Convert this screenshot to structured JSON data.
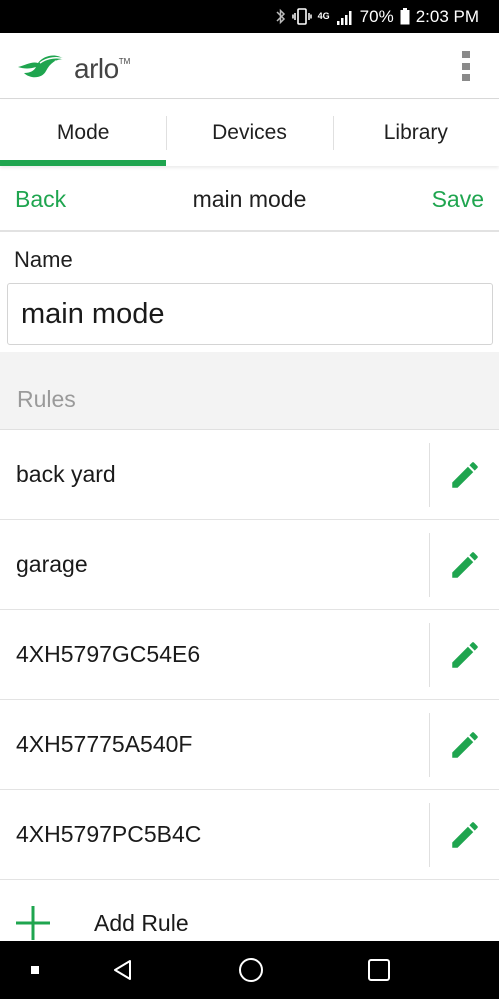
{
  "status_bar": {
    "battery": "70%",
    "time": "2:03 PM",
    "network": "4G",
    "icons": [
      "bluetooth-icon",
      "vibrate-icon",
      "network-4g-icon",
      "signal-icon",
      "battery-icon"
    ]
  },
  "app": {
    "logo_text": "arlo",
    "logo_tm": "TM"
  },
  "tabs": [
    {
      "label": "Mode",
      "active": true
    },
    {
      "label": "Devices",
      "active": false
    },
    {
      "label": "Library",
      "active": false
    }
  ],
  "toolbar": {
    "back_label": "Back",
    "title": "main mode",
    "save_label": "Save"
  },
  "name_section": {
    "label": "Name",
    "value": "main mode"
  },
  "rules": {
    "header": "Rules",
    "items": [
      {
        "label": "back yard"
      },
      {
        "label": "garage"
      },
      {
        "label": "4XH5797GC54E6"
      },
      {
        "label": "4XH57775A540F"
      },
      {
        "label": "4XH5797PC5B4C"
      }
    ],
    "add_label": "Add Rule"
  },
  "colors": {
    "accent": "#1fa54f",
    "muted_text": "#9a9a9a",
    "section_bg": "#f3f3f3"
  }
}
